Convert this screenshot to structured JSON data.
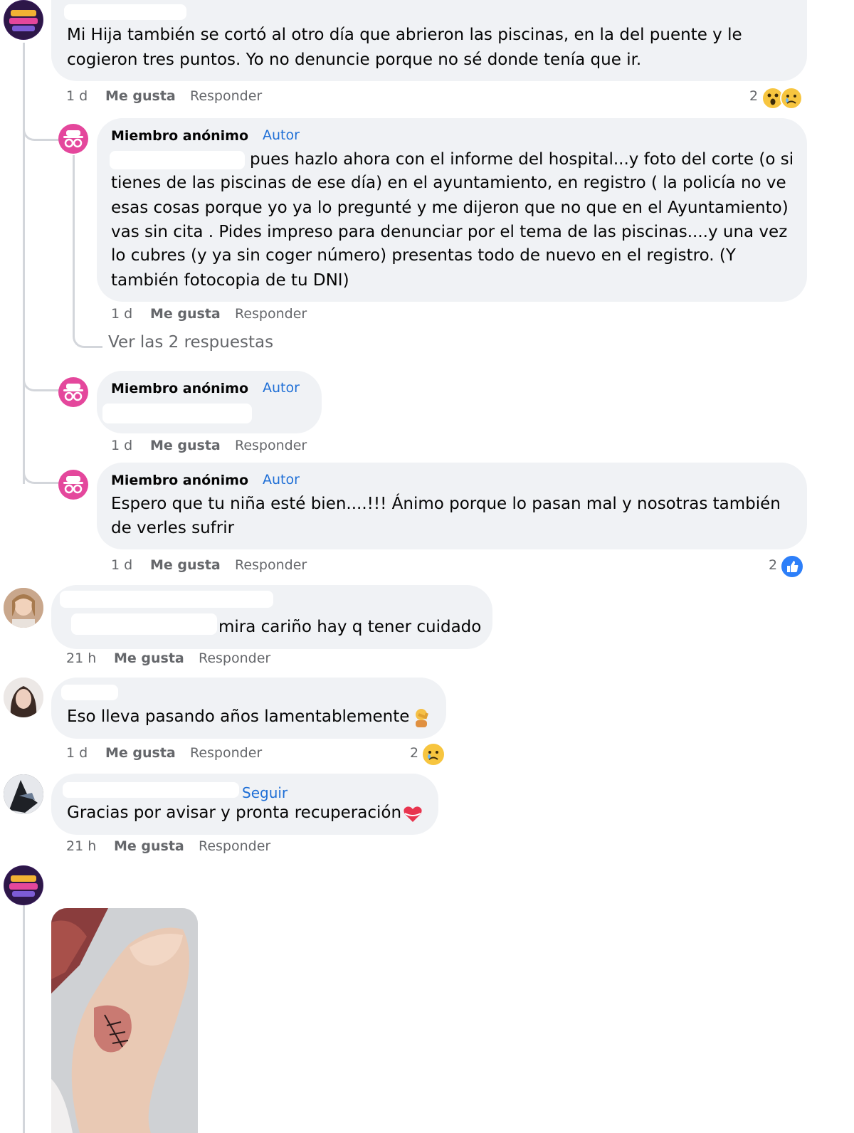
{
  "comments": {
    "c1": {
      "line1": "Mi Hija también se cortó al otro día que abrieron las piscinas, en la del puente y le",
      "line2": "cogieron tres puntos. Yo no denuncie porque no sé donde tenía que ir.",
      "time": "1 d",
      "like": "Me gusta",
      "reply": "Responder",
      "reactions": "2"
    },
    "r1": {
      "name": "Miembro anónimo",
      "badge": "Autor",
      "line1": "pues hazlo ahora con el informe del hospital...y foto del corte (o si",
      "line2": "tienes de las piscinas de ese día) en el ayuntamiento, en registro ( la policía no ve",
      "line3": "esas cosas porque yo ya lo pregunté y me dijeron que no que en el Ayuntamiento)",
      "line4": "vas sin cita . Pides impreso para denunciar por el tema de las piscinas....y una vez",
      "line5": "lo cubres (y ya sin coger número) presentas todo de nuevo en el registro. (Y",
      "line6": "también fotocopia de tu DNI)",
      "time": "1 d",
      "like": "Me gusta",
      "reply": "Responder"
    },
    "view_replies": "Ver las 2 respuestas",
    "r2": {
      "name": "Miembro anónimo",
      "badge": "Autor",
      "time": "1 d",
      "like": "Me gusta",
      "reply": "Responder"
    },
    "r3": {
      "name": "Miembro anónimo",
      "badge": "Autor",
      "line1": "Espero que tu niña esté bien....!!! Ánimo porque lo pasan mal y nosotras también",
      "line2": "de verles sufrir",
      "time": "1 d",
      "like": "Me gusta",
      "reply": "Responder",
      "reactions": "2"
    },
    "c2": {
      "text": "mira cariño hay q tener cuidado",
      "time": "21 h",
      "like": "Me gusta",
      "reply": "Responder"
    },
    "c3": {
      "text": "Eso lleva pasando años lamentablemente",
      "time": "1 d",
      "like": "Me gusta",
      "reply": "Responder",
      "reactions": "2"
    },
    "c4": {
      "follow": "Seguir",
      "text": "Gracias por avisar y pronta recuperación",
      "time": "21 h",
      "like": "Me gusta",
      "reply": "Responder"
    }
  },
  "colors": {
    "anon_avatar": "#e4479c",
    "badge": "#1f6fd6",
    "bubble": "#f0f2f5",
    "muted": "#65676b"
  },
  "icons": [
    "incognito-icon",
    "like-reaction-icon",
    "wow-reaction-icon",
    "sad-reaction-icon",
    "person-facepalm-emoji",
    "heart-emoji"
  ]
}
